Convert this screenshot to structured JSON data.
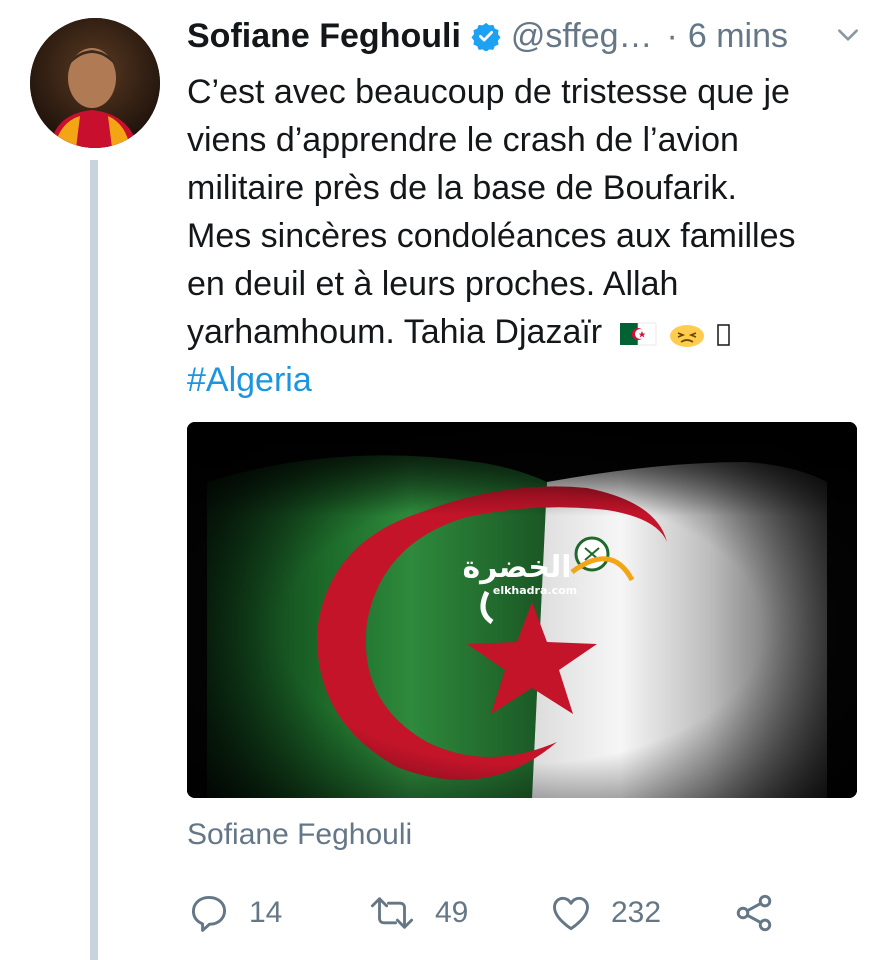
{
  "tweet": {
    "display_name": "Sofiane Feghouli",
    "handle": "@sffeg…",
    "separator": "·",
    "time": "6 mins",
    "text_lines": [
      "C’est avec beaucoup de tristesse que je",
      "viens d’apprendre le crash de l’avion",
      "militaire près de la base de Boufarik.",
      "Mes sincères condoléances aux familles",
      "en deuil et à leurs proches. Allah",
      "yarhamhoum. Tahia Djazaïr"
    ],
    "hashtag": "#Algeria",
    "card_title": "Sofiane Feghouli",
    "watermark": {
      "arabic": "الخضرة",
      "site": "elkhadra.com"
    }
  },
  "actions": {
    "reply_count": "14",
    "retweet_count": "49",
    "like_count": "232"
  },
  "icons": {
    "verified": "verified-badge-icon",
    "caret": "chevron-down-icon",
    "reply": "reply-icon",
    "retweet": "retweet-icon",
    "like": "heart-icon",
    "share": "share-icon"
  },
  "colors": {
    "link": "#1b95e0",
    "secondary_text": "#657786",
    "thread_line": "#c8d3dd"
  }
}
